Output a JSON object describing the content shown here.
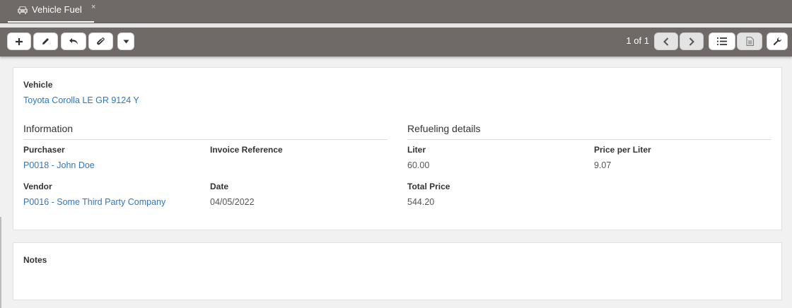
{
  "tab": {
    "label": "Vehicle Fuel",
    "close": "×",
    "icon": "car-icon"
  },
  "toolbar": {
    "pager": "1 of 1",
    "buttons": [
      "plus-icon",
      "pencil-icon",
      "undo-icon",
      "paperclip-icon",
      "caret-down-icon",
      "chevron-left-icon",
      "chevron-right-icon",
      "list-icon",
      "document-icon",
      "wrench-icon"
    ]
  },
  "record": {
    "vehicle_label": "Vehicle",
    "vehicle_value": "Toyota Corolla LE GR 9124 Y",
    "information": {
      "title": "Information",
      "purchaser_label": "Purchaser",
      "purchaser_value": "P0018 - John Doe",
      "invoice_label": "Invoice Reference",
      "invoice_value": "",
      "vendor_label": "Vendor",
      "vendor_value": "P0016 - Some Third Party Company",
      "date_label": "Date",
      "date_value": "04/05/2022"
    },
    "refueling": {
      "title": "Refueling details",
      "liter_label": "Liter",
      "liter_value": "60.00",
      "price_label": "Price per Liter",
      "price_value": "9.07",
      "total_label": "Total Price",
      "total_value": "544.20"
    }
  },
  "notes": {
    "label": "Notes",
    "value": ""
  },
  "colors": {
    "bar": "#6f6a68",
    "link": "#2a78c5"
  }
}
